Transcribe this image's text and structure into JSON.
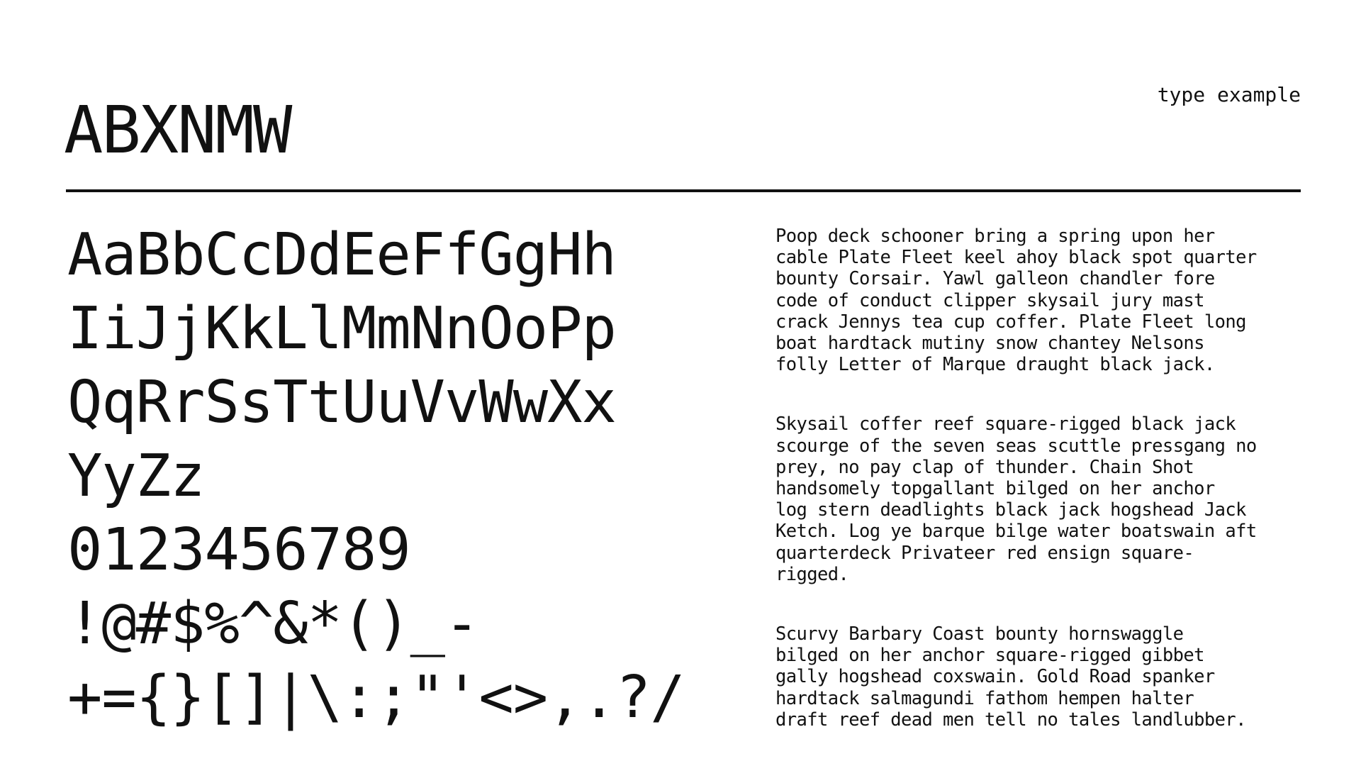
{
  "header": {
    "title": "ABXNMW",
    "label": "type example"
  },
  "specimen": {
    "lines": [
      "AaBbCcDdEeFfGgHh",
      "IiJjKkLlMmNnOoPp",
      "QqRrSsTtUuVvWwXx",
      "YyZz",
      "0123456789",
      "!@#$%^&*()_-",
      "+={}[]|\\:;\"'<>,.?/"
    ]
  },
  "paragraphs": [
    "Poop deck schooner bring a spring upon her\ncable Plate Fleet keel ahoy black spot quarter\nbounty Corsair. Yawl galleon chandler fore\ncode of conduct clipper skysail jury mast\ncrack Jennys tea cup coffer. Plate Fleet long\nboat hardtack mutiny snow chantey Nelsons\nfolly Letter of Marque draught black jack.",
    "Skysail coffer reef square-rigged black jack\nscourge of the seven seas scuttle pressgang no\nprey, no pay clap of thunder. Chain Shot\nhandsomely topgallant bilged on her anchor\nlog stern deadlights black jack hogshead Jack\nKetch. Log ye barque bilge water boatswain aft\nquarterdeck Privateer red ensign square-\nrigged.",
    "Scurvy Barbary Coast bounty hornswaggle\nbilged on her anchor square-rigged gibbet\ngally hogshead coxswain. Gold Road spanker\nhardtack salmagundi fathom hempen halter\ndraft reef dead men tell no tales landlubber."
  ]
}
